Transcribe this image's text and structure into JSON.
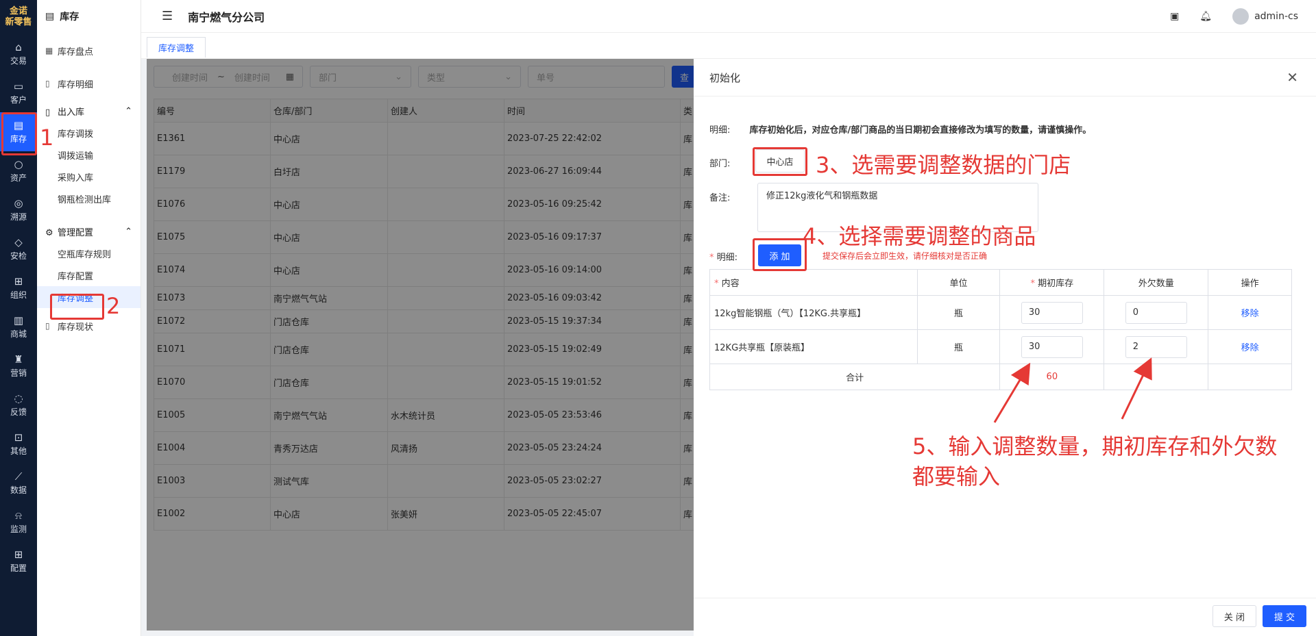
{
  "leftbar": {
    "logo_line1": "金诺",
    "logo_line2": "新零售",
    "items": [
      {
        "label": "交易",
        "icon": "bag-icon"
      },
      {
        "label": "客户",
        "icon": "id-card-icon"
      },
      {
        "label": "库存",
        "icon": "inventory-icon"
      },
      {
        "label": "资产",
        "icon": "bulb-icon"
      },
      {
        "label": "溯源",
        "icon": "compass-icon"
      },
      {
        "label": "安检",
        "icon": "shield-check-icon"
      },
      {
        "label": "组织",
        "icon": "org-icon"
      },
      {
        "label": "商城",
        "icon": "store-icon"
      },
      {
        "label": "营销",
        "icon": "trophy-icon"
      },
      {
        "label": "反馈",
        "icon": "chat-icon"
      },
      {
        "label": "其他",
        "icon": "apps-icon"
      },
      {
        "label": "数据",
        "icon": "chart-icon"
      },
      {
        "label": "监测",
        "icon": "alarm-icon"
      },
      {
        "label": "配置",
        "icon": "grid-icon"
      }
    ]
  },
  "subnav": {
    "title": "库存",
    "item1": "库存盘点",
    "item2": "库存明细",
    "group1": "出入库",
    "group1_children": [
      "库存调拨",
      "调拨运输",
      "采购入库",
      "钢瓶检测出库"
    ],
    "group2": "管理配置",
    "group2_children": [
      "空瓶库存规则",
      "库存配置",
      "库存调整"
    ],
    "item3": "库存现状"
  },
  "topbar": {
    "company": "南宁燃气分公司",
    "user": "admin-cs"
  },
  "tab": "库存调整",
  "filters": {
    "start": "创建时间",
    "sep": "~",
    "end": "创建时间",
    "dept": "部门",
    "type": "类型",
    "order": "单号",
    "query_btn": "查"
  },
  "list": {
    "headers": [
      "编号",
      "仓库/部门",
      "创建人",
      "时间",
      "类"
    ],
    "rows": [
      [
        "E1361",
        "中心店",
        "",
        "2023-07-25 22:42:02",
        "库"
      ],
      [
        "E1179",
        "白圩店",
        "",
        "2023-06-27 16:09:44",
        "库"
      ],
      [
        "E1076",
        "中心店",
        "",
        "2023-05-16 09:25:42",
        "库"
      ],
      [
        "E1075",
        "中心店",
        "",
        "2023-05-16 09:17:37",
        "库"
      ],
      [
        "E1074",
        "中心店",
        "",
        "2023-05-16 09:14:00",
        "库"
      ],
      [
        "E1073",
        "南宁燃气气站",
        "",
        "2023-05-16 09:03:42",
        "库"
      ],
      [
        "E1072",
        "门店仓库",
        "",
        "2023-05-15 19:37:34",
        "库"
      ],
      [
        "E1071",
        "门店仓库",
        "",
        "2023-05-15 19:02:49",
        "库"
      ],
      [
        "E1070",
        "门店仓库",
        "",
        "2023-05-15 19:01:52",
        "库"
      ],
      [
        "E1005",
        "南宁燃气气站",
        "水木统计员",
        "2023-05-05 23:53:46",
        "库"
      ],
      [
        "E1004",
        "青秀万达店",
        "风清扬",
        "2023-05-05 23:24:24",
        "库"
      ],
      [
        "E1003",
        "测试气库",
        "",
        "2023-05-05 23:02:27",
        "库"
      ],
      [
        "E1002",
        "中心店",
        "张美妍",
        "2023-05-05 22:45:07",
        "库"
      ]
    ]
  },
  "drawer": {
    "title": "初始化",
    "detail_label": "明细:",
    "detail_text": "库存初始化后，对应仓库/部门商品的当日期初会直接修改为填写的数量，请谨慎操作。",
    "dept_label": "部门:",
    "dept_value": "中心店",
    "remark_label": "备注:",
    "remark_value": "修正12kg液化气和钢瓶数据",
    "items_label": "明细:",
    "add_btn": "添 加",
    "tip": "提交保存后会立即生效，请仔细核对是否正确",
    "table_headers": [
      "内容",
      "单位",
      "期初库存",
      "外欠数量",
      "操作"
    ],
    "rows": [
      {
        "name": "12kg智能钢瓶（气）【12KG.共享瓶】",
        "unit": "瓶",
        "stock": "30",
        "owed": "0",
        "op": "移除"
      },
      {
        "name": "12KG共享瓶【原装瓶】",
        "unit": "瓶",
        "stock": "30",
        "owed": "2",
        "op": "移除"
      }
    ],
    "total_label": "合计",
    "total_value": "60",
    "close_btn": "关 闭",
    "submit_btn": "提 交"
  },
  "annotations": {
    "n1": "1",
    "n2": "2",
    "a3": "3、选需要调整数据的门店",
    "a4": "4、选择需要调整的商品",
    "a5_line1": "5、输入调整数量，期初库存和外欠数",
    "a5_line2": "都要输入"
  },
  "colors": {
    "accent": "#1f5eff",
    "annotation": "#e53935",
    "sidebar_bg": "#0f1c33"
  }
}
